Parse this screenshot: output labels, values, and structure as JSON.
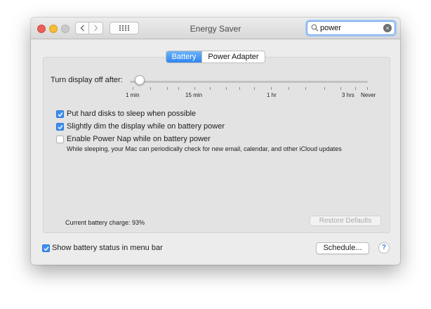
{
  "window": {
    "title": "Energy Saver"
  },
  "toolbar": {
    "search_value": "power",
    "clear_symbol": "×"
  },
  "tabs": [
    {
      "label": "Battery",
      "active": true
    },
    {
      "label": "Power Adapter",
      "active": false
    }
  ],
  "display_sleep": {
    "label": "Turn display off after:",
    "selected": "2 min",
    "ticks": [
      "1 min",
      "15 min",
      "1 hr",
      "3 hrs",
      "Never"
    ]
  },
  "options": [
    {
      "label": "Put hard disks to sleep when possible",
      "checked": true
    },
    {
      "label": "Slightly dim the display while on battery power",
      "checked": true
    },
    {
      "label": "Enable Power Nap while on battery power",
      "checked": false
    }
  ],
  "power_nap_note": "While sleeping, your Mac can periodically check for new email, calendar, and other iCloud updates",
  "battery_charge": "Current battery charge: 93%",
  "restore_label": "Restore Defaults",
  "show_status": {
    "label": "Show battery status in menu bar",
    "checked": true
  },
  "schedule_label": "Schedule...",
  "help_symbol": "?",
  "colors": {
    "accent": "#3d8ef0",
    "tab_active": "#2f86ef",
    "help": "#3a7ee6"
  }
}
